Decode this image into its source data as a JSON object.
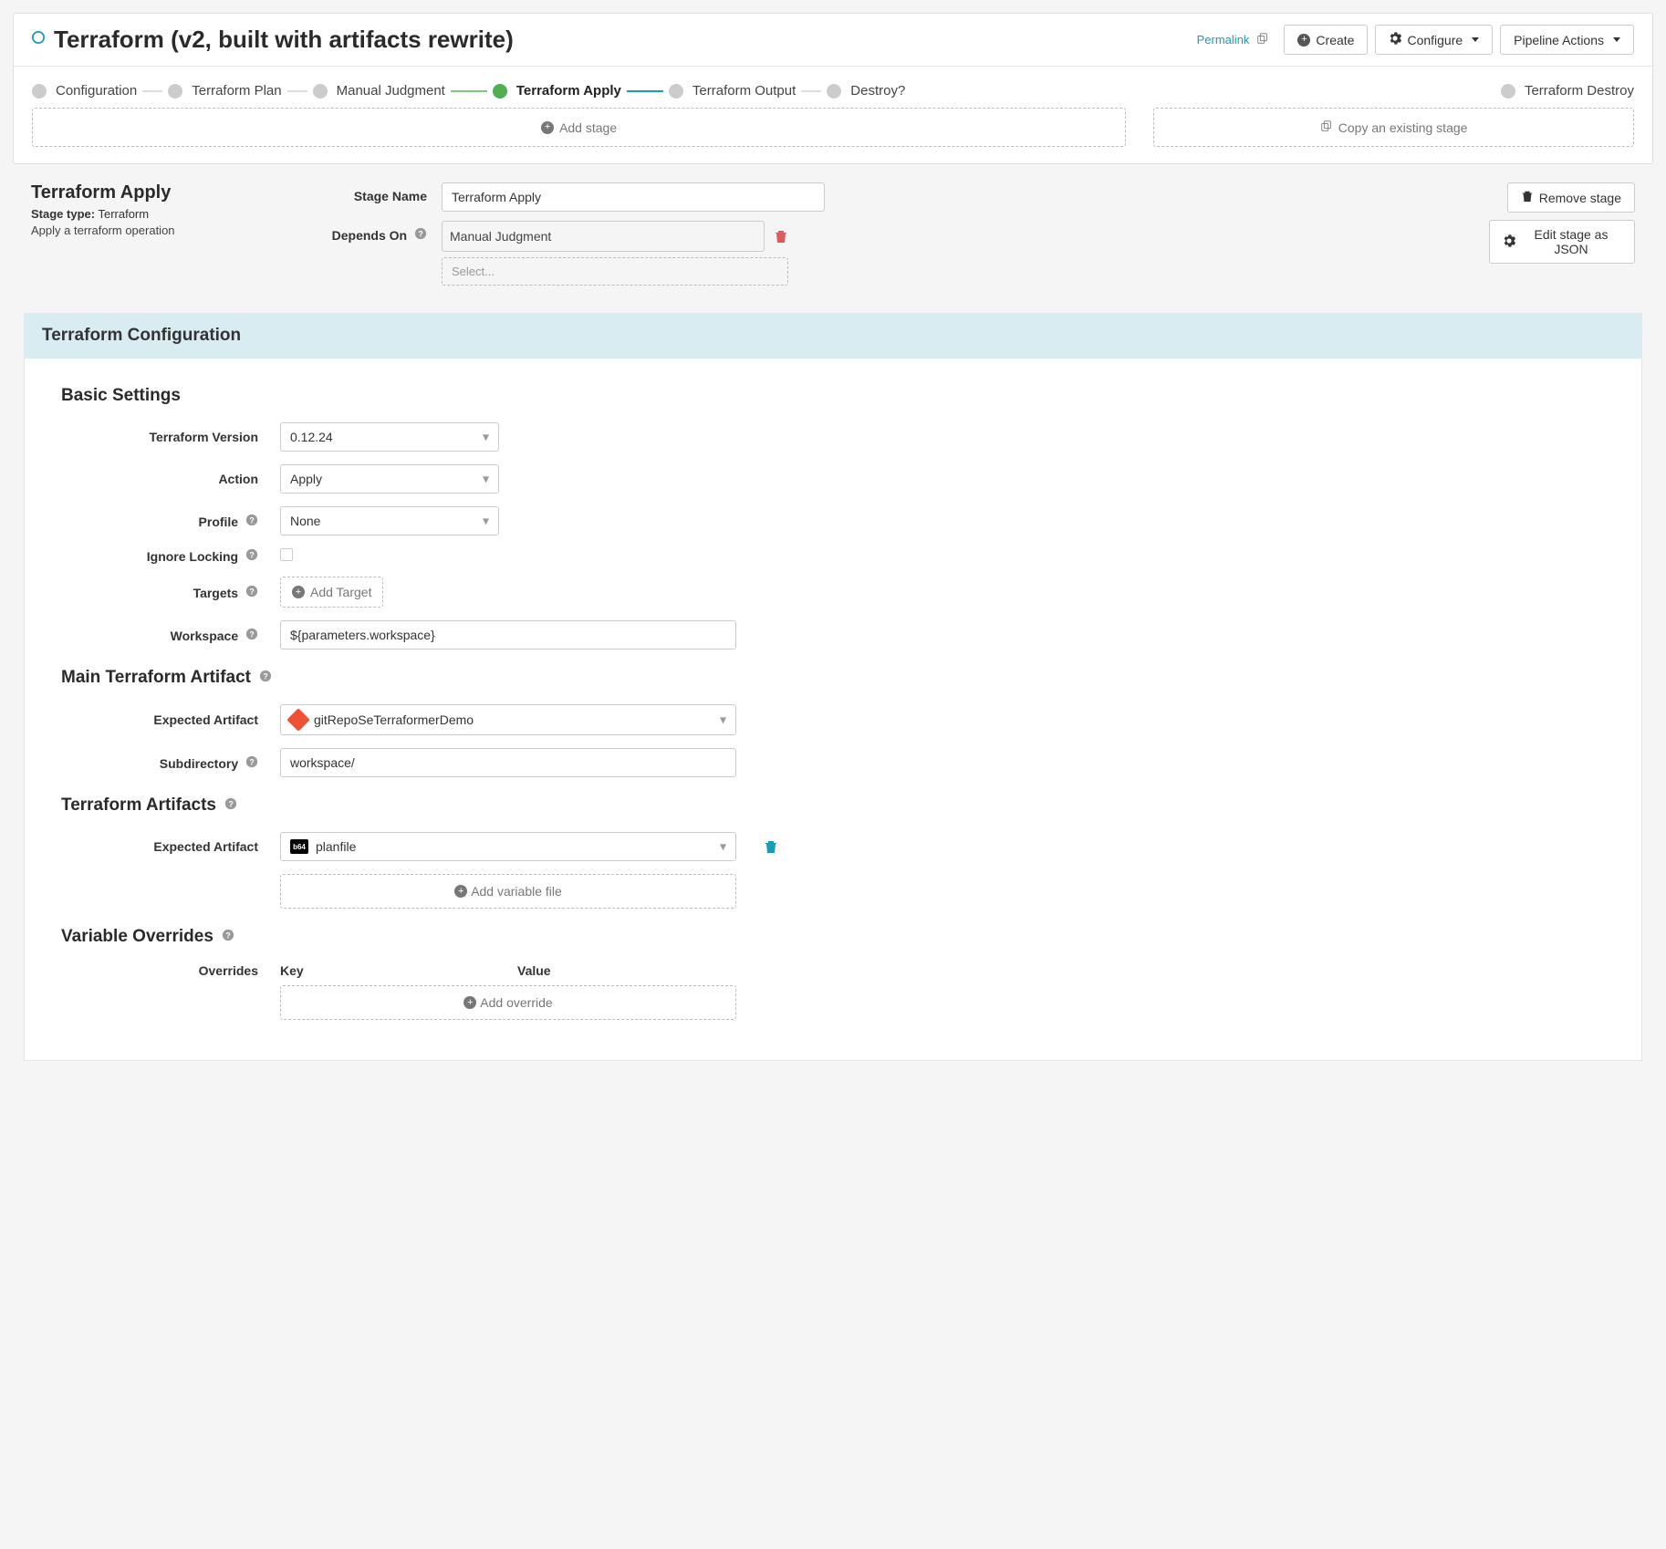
{
  "header": {
    "title": "Terraform (v2, built with artifacts rewrite)",
    "permalink": "Permalink",
    "create": "Create",
    "configure": "Configure",
    "pipeline_actions": "Pipeline Actions"
  },
  "stages": {
    "items": [
      {
        "label": "Configuration"
      },
      {
        "label": "Terraform Plan"
      },
      {
        "label": "Manual Judgment"
      },
      {
        "label": "Terraform Apply"
      },
      {
        "label": "Terraform Output"
      },
      {
        "label": "Destroy?"
      },
      {
        "label": "Terraform Destroy"
      }
    ],
    "add_stage": "Add stage",
    "copy_stage": "Copy an existing stage"
  },
  "stage_info": {
    "title": "Terraform Apply",
    "type_label": "Stage type:",
    "type_value": "Terraform",
    "description": "Apply a terraform operation",
    "stage_name_label": "Stage Name",
    "stage_name_value": "Terraform Apply",
    "depends_on_label": "Depends On",
    "depends_on_value": "Manual Judgment",
    "depends_on_placeholder": "Select...",
    "remove_stage": "Remove stage",
    "edit_json": "Edit stage as JSON"
  },
  "config": {
    "section_title": "Terraform Configuration",
    "basic_settings": "Basic Settings",
    "tf_version_label": "Terraform Version",
    "tf_version_value": "0.12.24",
    "action_label": "Action",
    "action_value": "Apply",
    "profile_label": "Profile",
    "profile_value": "None",
    "ignore_locking_label": "Ignore Locking",
    "targets_label": "Targets",
    "add_target": "Add Target",
    "workspace_label": "Workspace",
    "workspace_value": "${parameters.workspace}",
    "main_artifact_title": "Main Terraform Artifact",
    "expected_artifact_label": "Expected Artifact",
    "main_artifact_value": "gitRepoSeTerraformerDemo",
    "subdirectory_label": "Subdirectory",
    "subdirectory_value": "workspace/",
    "tf_artifacts_title": "Terraform Artifacts",
    "tf_artifact_value": "planfile",
    "tf_artifact_badge": "b64",
    "add_variable_file": "Add variable file",
    "variable_overrides_title": "Variable Overrides",
    "overrides_label": "Overrides",
    "key_header": "Key",
    "value_header": "Value",
    "add_override": "Add override"
  }
}
